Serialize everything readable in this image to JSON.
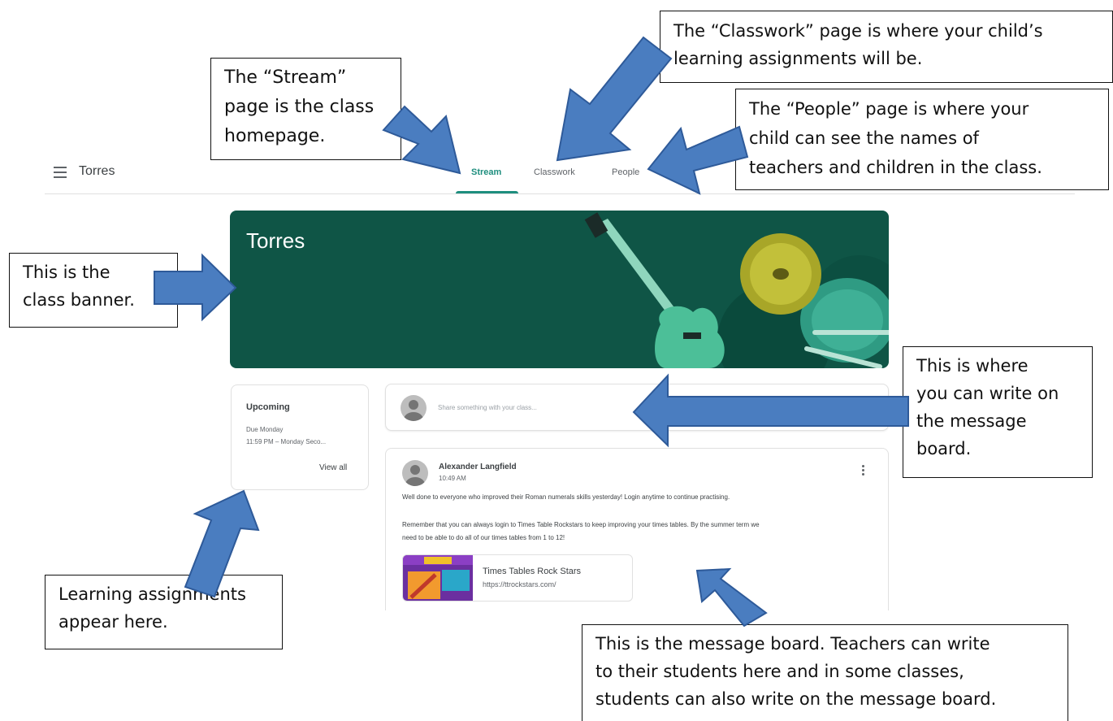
{
  "classroom": {
    "class_name": "Torres",
    "tabs": [
      {
        "label": "Stream",
        "active": true
      },
      {
        "label": "Classwork",
        "active": false
      },
      {
        "label": "People",
        "active": false
      }
    ],
    "banner_title": "Torres",
    "upcoming": {
      "title": "Upcoming",
      "due": "Due Monday",
      "item": "11:59 PM – Monday Seco...",
      "view_all": "View all"
    },
    "share": {
      "placeholder": "Share something with your class..."
    },
    "post": {
      "author": "Alexander Langfield",
      "time": "10:49 AM",
      "line1": "Well done to everyone who improved their Roman numerals skills yesterday! Login anytime to continue practising.",
      "line2": "Remember that you can always login to Times Table Rockstars to keep improving your times tables. By the summer term we",
      "line3": "need to be able to do all of our times tables from 1 to 12!",
      "attachment_title": "Times Tables Rock Stars",
      "attachment_url": "https://ttrockstars.com/"
    }
  },
  "callouts": {
    "stream": "The “Stream”\npage is the class\nhomepage.",
    "classwork": "The “Classwork” page is where your child’s\nlearning assignments will be.",
    "people": "The “People” page is where your\nchild can see the names of\nteachers and children in the class.",
    "banner": "This is the\nclass banner.",
    "board": "This is where\nyou can write on\nthe message\nboard.",
    "assignments": "Learning assignments\nappear here.",
    "message": "This is the message board. Teachers can write\nto their students here and in some classes,\nstudents can also write on the message board."
  },
  "colors": {
    "banner": "#0f5546",
    "accent": "#1e8e7e",
    "arrow_fill": "#4a7dc0",
    "arrow_stroke": "#2e5a99"
  },
  "icons": [
    "menu-icon",
    "avatar-icon",
    "more-vert-icon"
  ]
}
